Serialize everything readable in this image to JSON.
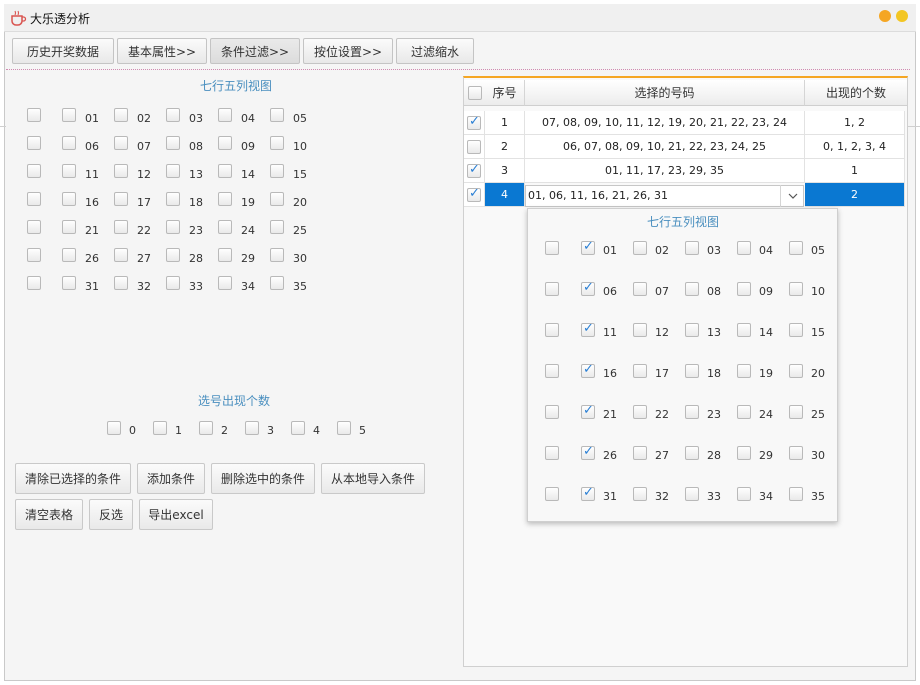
{
  "app": {
    "title": "大乐透分析"
  },
  "tabs": [
    "历史开奖数据",
    "基本属性>>",
    "条件过滤>>",
    "按位设置>>",
    "过滤缩水"
  ],
  "left": {
    "grid_title": "七行五列视图",
    "numbers": [
      "01",
      "02",
      "03",
      "04",
      "05",
      "06",
      "07",
      "08",
      "09",
      "10",
      "11",
      "12",
      "13",
      "14",
      "15",
      "16",
      "17",
      "18",
      "19",
      "20",
      "21",
      "22",
      "23",
      "24",
      "25",
      "26",
      "27",
      "28",
      "29",
      "30",
      "31",
      "32",
      "33",
      "34",
      "35"
    ],
    "count_title": "选号出现个数",
    "counts": [
      "0",
      "1",
      "2",
      "3",
      "4",
      "5"
    ],
    "buttons_row1": [
      "清除已选择的条件",
      "添加条件",
      "删除选中的条件",
      "从本地导入条件"
    ],
    "buttons_row2": [
      "清空表格",
      "反选",
      "导出excel"
    ]
  },
  "table": {
    "headers": [
      "序号",
      "选择的号码",
      "出现的个数"
    ],
    "rows": [
      {
        "checked": true,
        "no": "1",
        "numbers": "07, 08, 09, 10, 11, 12, 19, 20, 21, 22, 23, 24",
        "count": "1, 2"
      },
      {
        "checked": false,
        "no": "2",
        "numbers": "06, 07, 08, 09, 10, 21, 22, 23, 24, 25",
        "count": "0, 1, 2, 3, 4"
      },
      {
        "checked": true,
        "no": "3",
        "numbers": "01, 11, 17, 23, 29, 35",
        "count": "1"
      },
      {
        "checked": true,
        "no": "4",
        "numbers": "01, 06, 11, 16, 21, 26, 31",
        "count": "2"
      }
    ]
  },
  "popup": {
    "title": "七行五列视图",
    "numbers": [
      "01",
      "02",
      "03",
      "04",
      "05",
      "06",
      "07",
      "08",
      "09",
      "10",
      "11",
      "12",
      "13",
      "14",
      "15",
      "16",
      "17",
      "18",
      "19",
      "20",
      "21",
      "22",
      "23",
      "24",
      "25",
      "26",
      "27",
      "28",
      "29",
      "30",
      "31",
      "32",
      "33",
      "34",
      "35"
    ],
    "checked": [
      "01",
      "06",
      "11",
      "16",
      "21",
      "26",
      "31"
    ]
  },
  "colors": {
    "accent": "#0a78d2",
    "section_title": "#4a8fbf",
    "table_top_border": "#f5a623"
  }
}
